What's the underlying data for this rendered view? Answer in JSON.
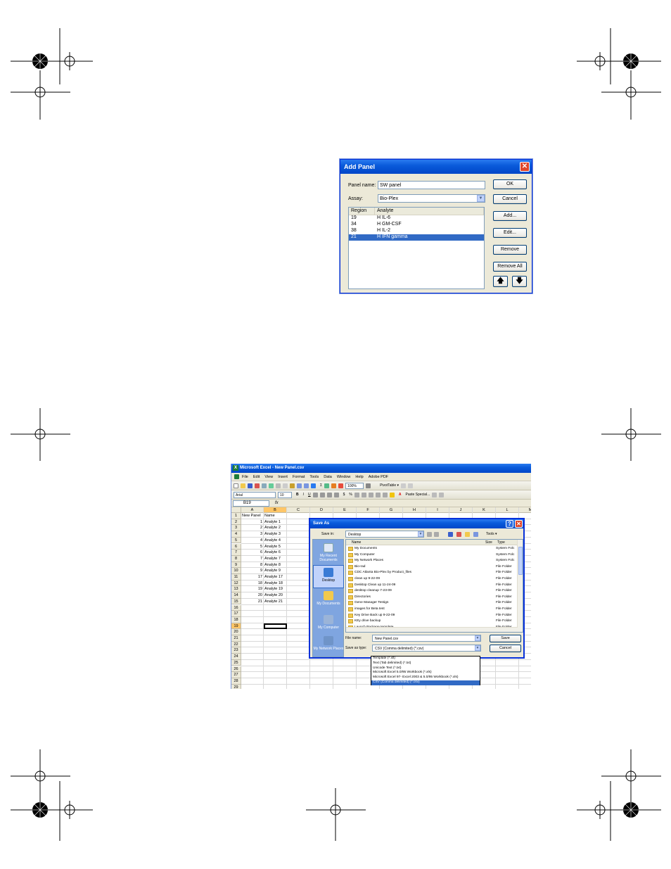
{
  "add_panel": {
    "title": "Add Panel",
    "close": "✕",
    "panel_name_label": "Panel name:",
    "panel_name_value": "SW panel",
    "assay_label": "Assay:",
    "assay_value": "Bio-Plex",
    "columns": [
      "Region",
      "Analyte"
    ],
    "rows": [
      {
        "region": "19",
        "analyte": "H IL-6",
        "selected": false
      },
      {
        "region": "34",
        "analyte": "H GM-CSF",
        "selected": false
      },
      {
        "region": "38",
        "analyte": "H IL-2",
        "selected": false
      },
      {
        "region": "21",
        "analyte": "H IFN gamma",
        "selected": true
      }
    ],
    "buttons": {
      "ok": "OK",
      "cancel": "Cancel",
      "add": "Add...",
      "edit": "Edit...",
      "remove": "Remove",
      "remove_all": "Remove All"
    },
    "up_arrow": "🡅",
    "down_arrow": "🡇"
  },
  "excel": {
    "title": "Microsoft Excel - New Panel.csv",
    "logo": "X",
    "menu": [
      "File",
      "Edit",
      "View",
      "Insert",
      "Format",
      "Tools",
      "Data",
      "Window",
      "Help",
      "Adobe PDF"
    ],
    "zoom": "100%",
    "pivot": "PivotTable ▾",
    "font_name": "Arial",
    "font_size": "10",
    "paste_special": "Paste Special...",
    "name_box": "B19",
    "fx": "fx",
    "columns": [
      "A",
      "B",
      "C",
      "D",
      "E",
      "F",
      "G",
      "H",
      "I",
      "J",
      "K",
      "L",
      "M"
    ],
    "selected_column": "B",
    "selected_row": "19",
    "rows": [
      "1",
      "2",
      "3",
      "4",
      "5",
      "6",
      "7",
      "8",
      "9",
      "10",
      "11",
      "12",
      "13",
      "14",
      "15",
      "16",
      "17",
      "18",
      "19",
      "20",
      "21",
      "22",
      "23",
      "24",
      "25",
      "26",
      "27",
      "28",
      "29"
    ],
    "cells": [
      {
        "a": "New Panel",
        "b": "Name"
      },
      {
        "a": "1",
        "b": "Analyte 1"
      },
      {
        "a": "2",
        "b": "Analyte 2"
      },
      {
        "a": "3",
        "b": "Analyte 3"
      },
      {
        "a": "4",
        "b": "Analyte 4"
      },
      {
        "a": "5",
        "b": "Analyte 5"
      },
      {
        "a": "6",
        "b": "Analyte 6"
      },
      {
        "a": "7",
        "b": "Analyte 7"
      },
      {
        "a": "8",
        "b": "Analyte 8"
      },
      {
        "a": "9",
        "b": "Analyte 9"
      },
      {
        "a": "17",
        "b": "Analyte 17"
      },
      {
        "a": "18",
        "b": "Analyte 18"
      },
      {
        "a": "19",
        "b": "Analyte 19"
      },
      {
        "a": "20",
        "b": "Analyte 20"
      },
      {
        "a": "21",
        "b": "Analyte 21"
      }
    ]
  },
  "save_as": {
    "title": "Save As",
    "help": "?",
    "close": "✕",
    "save_in_label": "Save in:",
    "save_in_value": "Desktop",
    "tools_label": "Tools ▾",
    "places": [
      "My Recent Documents",
      "Desktop",
      "My Documents",
      "My Computer",
      "My Network Places"
    ],
    "active_place": "Desktop",
    "list_headers": {
      "name": "Name",
      "size": "Size",
      "type": "Type"
    },
    "files": [
      {
        "name": "My Documents",
        "type": "System Folc"
      },
      {
        "name": "My Computer",
        "type": "System Folc"
      },
      {
        "name": "My Network Places",
        "type": "System Folc"
      },
      {
        "name": "Bio-rad",
        "type": "File Folder"
      },
      {
        "name": "CDC Atlanta Bio-Plex by Product_files",
        "type": "File Folder"
      },
      {
        "name": "clean up 9-22-09",
        "type": "File Folder"
      },
      {
        "name": "Desktop Clean up 11-24-09",
        "type": "File Folder"
      },
      {
        "name": "desktop cleanup 7-23-09",
        "type": "File Folder"
      },
      {
        "name": "Directories",
        "type": "File Folder"
      },
      {
        "name": "Gene Manager Testign",
        "type": "File Folder"
      },
      {
        "name": "images for Beta test",
        "type": "File Folder"
      },
      {
        "name": "Key Drive Back up 9-22-09",
        "type": "File Folder"
      },
      {
        "name": "KEy drive backup",
        "type": "File Folder"
      },
      {
        "name": "Launch Package template",
        "type": "File Folder"
      }
    ],
    "file_name_label": "File name:",
    "file_name_value": "New Panel.csv",
    "save_as_type_label": "Save as type:",
    "save_as_type_value": "CSV (Comma delimited) (*.csv)",
    "save_button": "Save",
    "cancel_button": "Cancel",
    "type_options": [
      {
        "label": "Template (*.xlt)",
        "selected": false
      },
      {
        "label": "Text (Tab delimited) (*.txt)",
        "selected": false
      },
      {
        "label": "Unicode Text (*.txt)",
        "selected": false
      },
      {
        "label": "Microsoft Excel 5.0/95 Workbook (*.xls)",
        "selected": false
      },
      {
        "label": "Microsoft Excel 97- Excel 2003 & 5.0/95 Workbook (*.xls)",
        "selected": false
      },
      {
        "label": "CSV (Comma delimited) (*.csv)",
        "selected": true
      }
    ]
  },
  "colors": {
    "xp_blue": "#0a5bdb",
    "selection": "#316ac5",
    "dialog_bg": "#ece9d8"
  }
}
